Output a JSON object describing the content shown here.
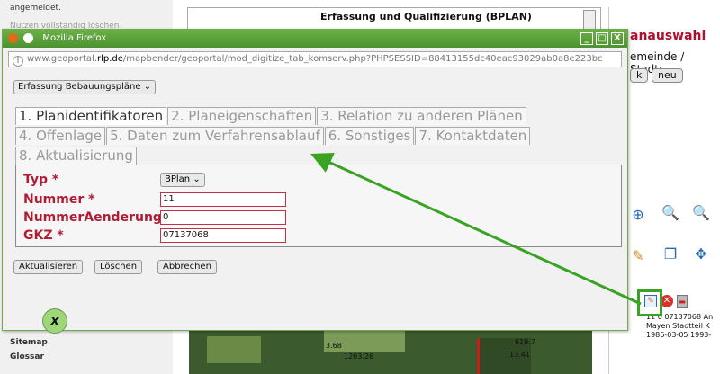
{
  "background": {
    "sidebar": {
      "top_text": "angemeldet.",
      "top_text_2": "Nutzen vollständig löschen",
      "items": [
        "Sitemap",
        "Glossar"
      ]
    },
    "plan_title": "Erfassung und Qualifizierung (BPLAN)",
    "right_panel": {
      "heading": "anauswahl",
      "gemeinde_label": "emeinde / Stadt:",
      "btn_k": "k",
      "btn_neu": "neu"
    },
    "map_labels": [
      "3.68",
      "1203.26",
      "619.7",
      "13.41"
    ],
    "result_text": "11 0 07137068 An\nMayen Stadtteil K\n1986-03-05 1993-"
  },
  "firefox": {
    "title": "Mozilla Firefox",
    "url_prefix": "www.geoportal.",
    "url_host": "rlp.de",
    "url_rest": "/mapbender/geoportal/mod_digitize_tab_komserv.php?PHPSESSID=88413155dc40eac93029ab0a8e223bc",
    "controls": [
      "_",
      "□",
      "X"
    ]
  },
  "form": {
    "select_label": "Erfassung Bebauungspläne",
    "tabs": [
      "1. Planidentifikatoren",
      "2. Planeigenschaften",
      "3. Relation zu anderen Plänen",
      "4. Offenlage",
      "5. Daten zum Verfahrensablauf",
      "6. Sonstiges",
      "7. Kontaktdaten",
      "8. Aktualisierung"
    ],
    "active_tab": 0,
    "fields": {
      "typ_label": "Typ *",
      "typ_value": "BPlan",
      "nummer_label": "Nummer *",
      "nummer_value": "11",
      "nummer_aenderung_label": "NummerAenderung *",
      "nummer_aenderung_value": "0",
      "gkz_label": "GKZ *",
      "gkz_value": "07137068"
    },
    "buttons": {
      "update": "Aktualisieren",
      "delete": "Löschen",
      "cancel": "Abbrechen"
    },
    "close_label": "x"
  },
  "colors": {
    "annotation": "#3aa324",
    "label_red": "#b01c34",
    "titlebar_green": "#5aa33a"
  },
  "icons": [
    "zoom-in-icon",
    "zoom-out-icon",
    "edit-icon",
    "copy-icon",
    "pan-icon",
    "digitize-icon",
    "delete-icon",
    "trash-icon"
  ]
}
